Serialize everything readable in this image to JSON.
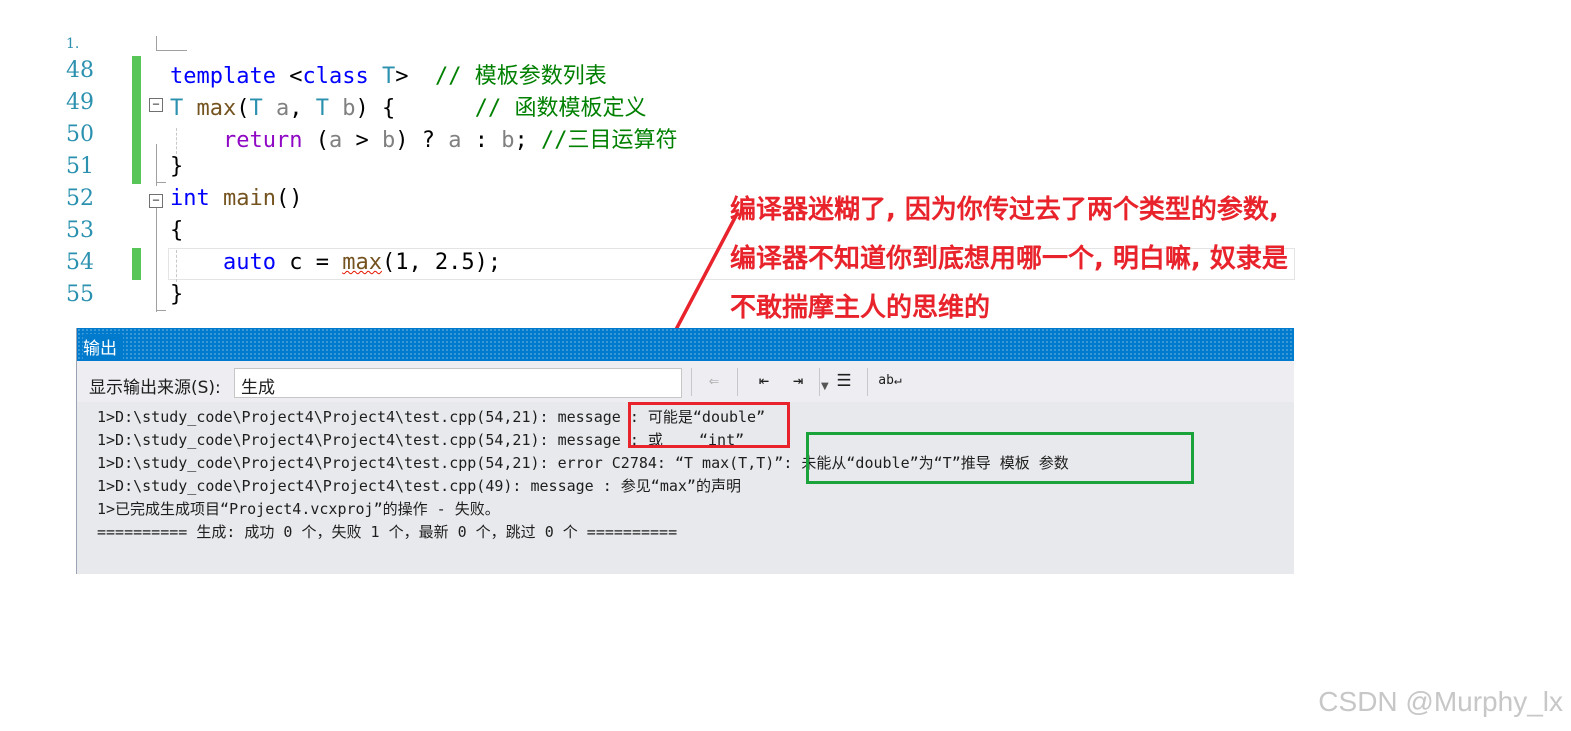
{
  "editor": {
    "lines": [
      {
        "num": "48",
        "tokens": [
          {
            "t": "template",
            "c": "kw"
          },
          {
            "t": " <",
            "c": "p"
          },
          {
            "t": "class",
            "c": "kw"
          },
          {
            "t": " T",
            "c": "ty"
          },
          {
            "t": ">  ",
            "c": "p"
          },
          {
            "t": "// 模板参数列表",
            "c": "cm"
          }
        ]
      },
      {
        "num": "49",
        "tokens": [
          {
            "t": "T",
            "c": "ty"
          },
          {
            "t": " ",
            "c": "p"
          },
          {
            "t": "max",
            "c": "fn"
          },
          {
            "t": "(",
            "c": "p"
          },
          {
            "t": "T",
            "c": "ty"
          },
          {
            "t": " a",
            "c": "par"
          },
          {
            "t": ", ",
            "c": "p"
          },
          {
            "t": "T",
            "c": "ty"
          },
          {
            "t": " b",
            "c": "par"
          },
          {
            "t": ") {      ",
            "c": "p"
          },
          {
            "t": "// 函数模板定义",
            "c": "cm"
          }
        ]
      },
      {
        "num": "50",
        "tokens": [
          {
            "t": "    ",
            "c": "p"
          },
          {
            "t": "return",
            "c": "ctl"
          },
          {
            "t": " (",
            "c": "p"
          },
          {
            "t": "a",
            "c": "par"
          },
          {
            "t": " > ",
            "c": "p"
          },
          {
            "t": "b",
            "c": "par"
          },
          {
            "t": ") ? ",
            "c": "p"
          },
          {
            "t": "a",
            "c": "par"
          },
          {
            "t": " : ",
            "c": "p"
          },
          {
            "t": "b",
            "c": "par"
          },
          {
            "t": "; ",
            "c": "p"
          },
          {
            "t": "//三目运算符",
            "c": "cm"
          }
        ]
      },
      {
        "num": "51",
        "tokens": [
          {
            "t": "}",
            "c": "p"
          }
        ]
      },
      {
        "num": "52",
        "tokens": [
          {
            "t": "int",
            "c": "kw"
          },
          {
            "t": " ",
            "c": "p"
          },
          {
            "t": "main",
            "c": "fn"
          },
          {
            "t": "()",
            "c": "p"
          }
        ]
      },
      {
        "num": "53",
        "tokens": [
          {
            "t": "{",
            "c": "p"
          }
        ]
      },
      {
        "num": "54",
        "tokens": [
          {
            "t": "    ",
            "c": "p"
          },
          {
            "t": "auto",
            "c": "kw"
          },
          {
            "t": " c = ",
            "c": "p"
          },
          {
            "t": "max",
            "c": "fn squig"
          },
          {
            "t": "(1, 2.5);",
            "c": "p"
          }
        ]
      },
      {
        "num": "55",
        "tokens": [
          {
            "t": "}",
            "c": "p"
          }
        ]
      }
    ]
  },
  "annotation": {
    "lines": [
      "编译器迷糊了, 因为你传过去了两个类型的参数,",
      "编译器不知道你到底想用哪一个, 明白嘛, 奴隶是",
      "不敢揣摩主人的思维的"
    ]
  },
  "output_panel": {
    "title": "输出",
    "source_label": "显示输出来源(S):",
    "source_value": "生成",
    "toolbar_icons": [
      "go-to-previous-message-icon",
      "previous-message-icon",
      "next-message-icon",
      "clear-all-icon",
      "toggle-word-wrap-icon"
    ],
    "lines": [
      "1>D:\\study_code\\Project4\\Project4\\test.cpp(54,21): message : 可能是“double”",
      "1>D:\\study_code\\Project4\\Project4\\test.cpp(54,21): message : 或    “int”",
      "1>D:\\study_code\\Project4\\Project4\\test.cpp(54,21): error C2784: “T max(T,T)”: 未能从“double”为“T”推导 模板 参数",
      "1>D:\\study_code\\Project4\\Project4\\test.cpp(49): message : 参见“max”的声明",
      "1>已完成生成项目“Project4.vcxproj”的操作 - 失败。",
      "========== 生成: 成功 0 个，失败 1 个，最新 0 个，跳过 0 个 =========="
    ]
  },
  "colors": {
    "accent": "#007acc",
    "annotation_red": "#e8232b",
    "highlight_green": "#1aa33b",
    "change_bar": "#57c557"
  },
  "watermark": "CSDN @Murphy_lx"
}
